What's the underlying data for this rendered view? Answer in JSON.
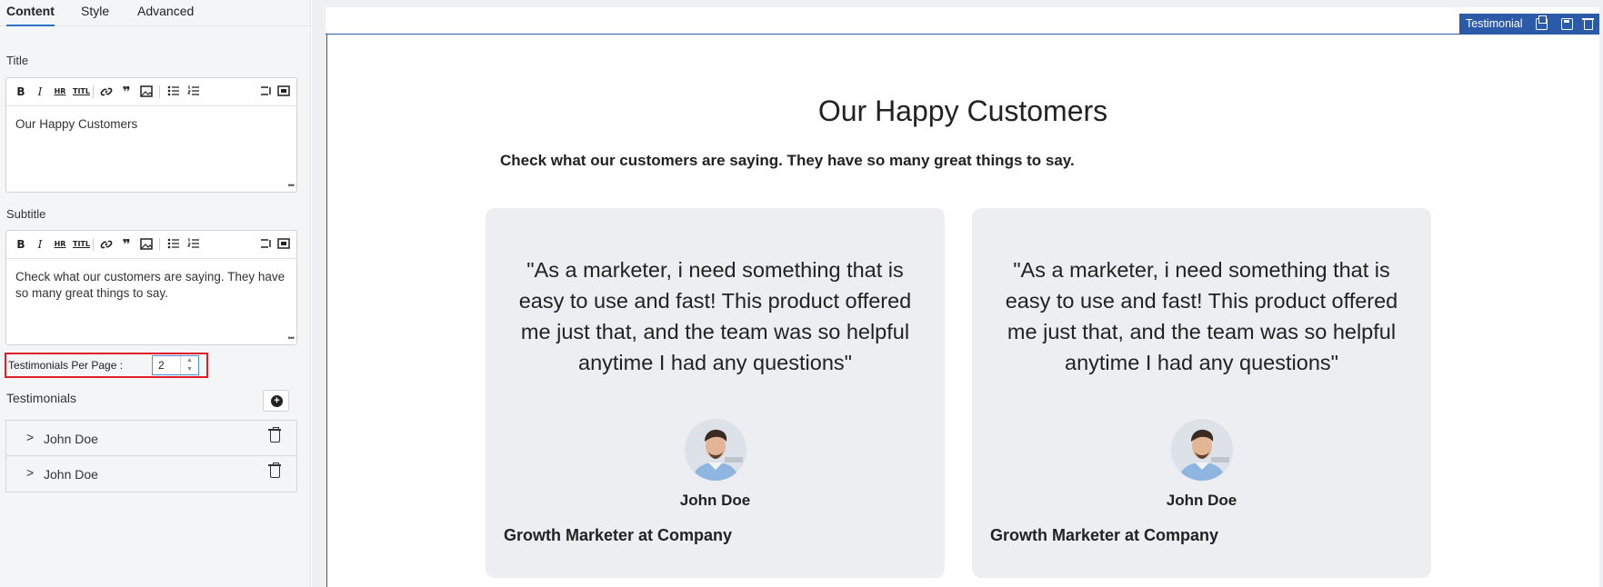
{
  "tabs": [
    {
      "label": "Content"
    },
    {
      "label": "Style"
    },
    {
      "label": "Advanced"
    }
  ],
  "title_field": {
    "label": "Title",
    "value": "Our Happy Customers"
  },
  "subtitle_field": {
    "label": "Subtitle",
    "value": "Check what our customers are saying. They have so many great things to say."
  },
  "toolbar": {
    "bold": "B",
    "italic": "I",
    "hr": "HR",
    "html": "TITL",
    "icons": [
      "bold-icon",
      "italic-icon",
      "horizontal-rule-icon",
      "html-icon",
      "link-icon",
      "quote-icon",
      "image-icon",
      "bullet-list-icon",
      "numbered-list-icon",
      "source-icon",
      "maximize-icon"
    ]
  },
  "per_page": {
    "label": "Testimonials Per Page :",
    "value": "2"
  },
  "testimonials": {
    "heading": "Testimonials",
    "items": [
      {
        "name": "John Doe"
      },
      {
        "name": "John Doe"
      }
    ]
  },
  "widget_bar": {
    "title": "Testimonial"
  },
  "preview": {
    "heading": "Our Happy Customers",
    "subheading": "Check what our customers are saying. They have so many great things to say.",
    "cards": [
      {
        "quote": "\"As a marketer, i need something that is easy to use and fast! This product offered me just that, and the team was so helpful anytime I had any questions\"",
        "name": "John Doe",
        "role": "Growth Marketer at Company"
      },
      {
        "quote": "\"As a marketer, i need something that is easy to use and fast! This product offered me just that, and the team was so helpful anytime I had any questions\"",
        "name": "John Doe",
        "role": "Growth Marketer at Company"
      }
    ]
  },
  "colors": {
    "accent": "#2a5aa8",
    "highlight": "#e01e2a",
    "card_bg": "#eceef1"
  }
}
